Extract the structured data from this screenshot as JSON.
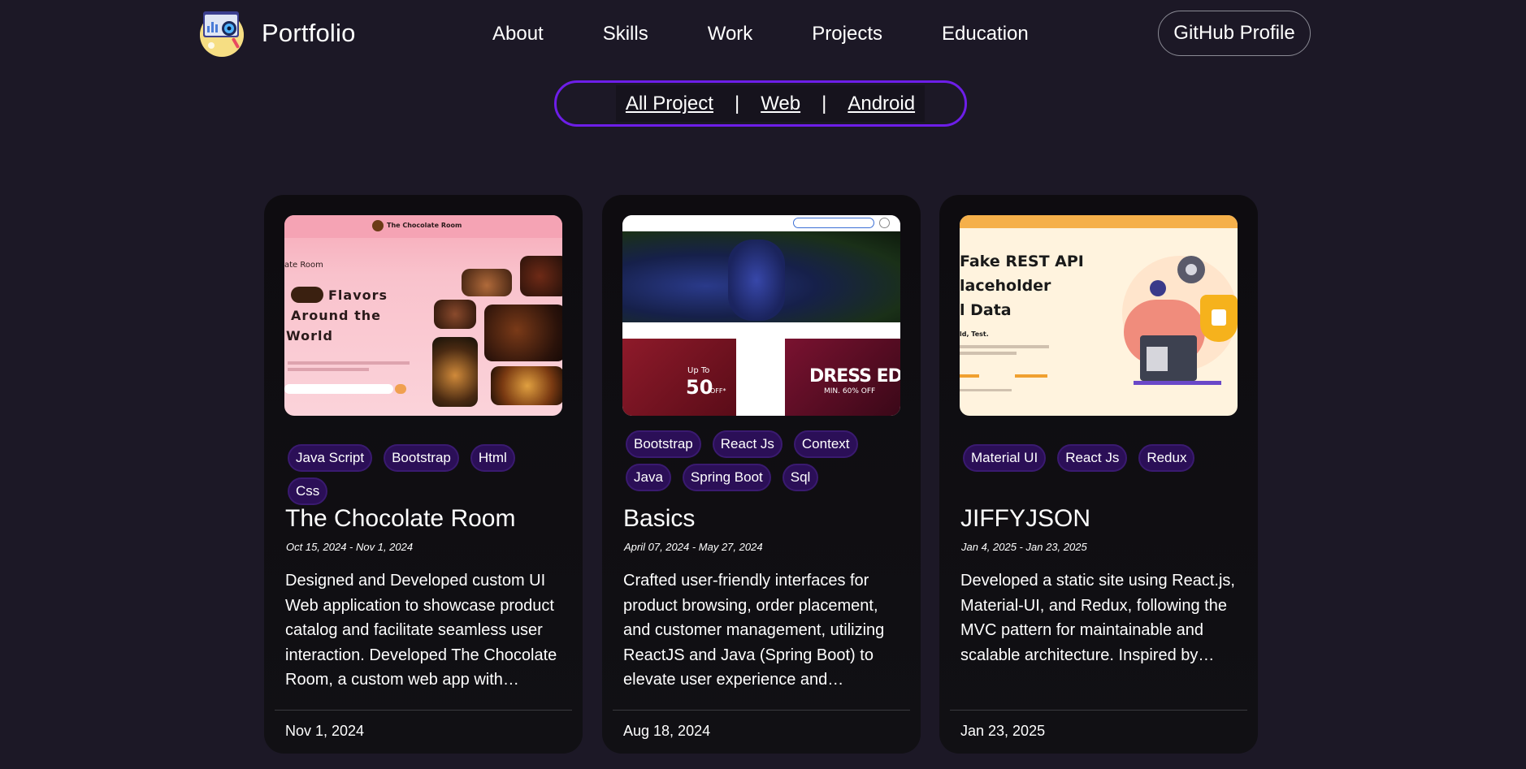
{
  "brand": {
    "name": "Portfolio"
  },
  "nav": {
    "links": [
      "About",
      "Skills",
      "Work",
      "Projects",
      "Education"
    ],
    "github_label": "GitHub Profile"
  },
  "filter": {
    "items": [
      "All Project",
      "Web",
      "Android"
    ],
    "separator": "|"
  },
  "projects": [
    {
      "title": "The Chocolate Room",
      "date_range": "Oct 15, 2024 - Nov 1, 2024",
      "tags": [
        "Java Script",
        "Bootstrap",
        "Html",
        "Css"
      ],
      "description": "Designed and Developed custom UI Web application to showcase product catalog and facilitate seamless user interaction. Developed The Chocolate Room, a custom web app with…",
      "footer_date": "Nov 1, 2024",
      "image": {
        "header": "The Chocolate Room",
        "subtitle": "ate Room",
        "headline_1": "Flavors",
        "headline_2": "Around the",
        "headline_3": "World"
      }
    },
    {
      "title": "Basics",
      "date_range": "April 07, 2024 - May 27, 2024",
      "tags": [
        "Bootstrap",
        "React Js",
        "Context",
        "Java",
        "Spring Boot",
        "Sql"
      ],
      "description": "Crafted user-friendly interfaces for product browsing, order placement, and customer management, utilizing ReactJS and Java (Spring Boot) to elevate user experience and…",
      "footer_date": "Aug 18, 2024",
      "image": {
        "promo_left": "Up To",
        "promo_left_value": "50",
        "promo_left_off": "OFF*",
        "promo_right": "DRESS EDIT",
        "promo_right_sub": "MIN. 60% OFF"
      }
    },
    {
      "title": "JIFFYJSON",
      "date_range": "Jan 4, 2025 - Jan 23, 2025",
      "tags": [
        "Material UI",
        "React Js",
        "Redux"
      ],
      "description": "Developed a static site using React.js, Material-UI, and Redux, following the MVC pattern for maintainable and scalable architecture. Inspired by…",
      "footer_date": "Jan 23, 2025",
      "image": {
        "line_1": "Fake REST API",
        "line_2": "laceholder",
        "line_3": "l Data",
        "small": "ld, Test."
      }
    }
  ],
  "colors": {
    "background": "#1c1826",
    "accent": "#6d1ee8",
    "tag_bg": "#2b0f57",
    "card_bg": "#0e0c10"
  }
}
